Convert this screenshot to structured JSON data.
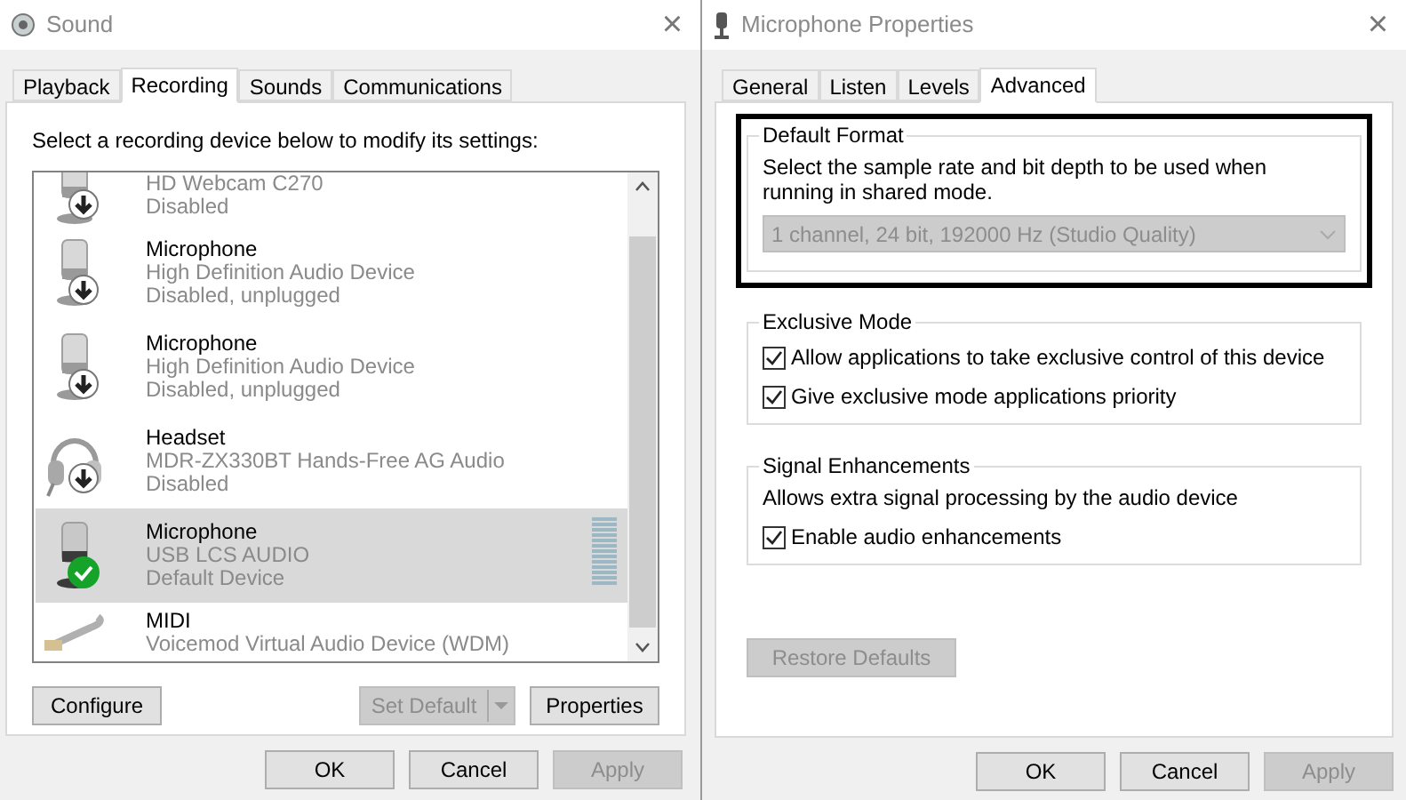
{
  "sound_window": {
    "title": "Sound",
    "close": "×",
    "tabs": [
      {
        "label": "Playback",
        "selected": false
      },
      {
        "label": "Recording",
        "selected": true
      },
      {
        "label": "Sounds",
        "selected": false
      },
      {
        "label": "Communications",
        "selected": false
      }
    ],
    "instruction": "Select a recording device below to modify its settings:",
    "devices": [
      {
        "kind": "webcam",
        "description": "HD Webcam C270",
        "status": "Disabled",
        "disabled": true,
        "default": false,
        "selected": false
      },
      {
        "kind": "mic",
        "name": "Microphone",
        "description": "High Definition Audio Device",
        "status": "Disabled, unplugged",
        "disabled": true,
        "default": false,
        "selected": false
      },
      {
        "kind": "mic",
        "name": "Microphone",
        "description": "High Definition Audio Device",
        "status": "Disabled, unplugged",
        "disabled": true,
        "default": false,
        "selected": false
      },
      {
        "kind": "headset",
        "name": "Headset",
        "description": "MDR-ZX330BT Hands-Free AG Audio",
        "status": "Disabled",
        "disabled": true,
        "default": false,
        "selected": false
      },
      {
        "kind": "mic",
        "name": "Microphone",
        "description": "USB LCS AUDIO",
        "status": "Default Device",
        "disabled": false,
        "default": true,
        "selected": true
      },
      {
        "kind": "midi",
        "name": "MIDI",
        "description": "Voicemod Virtual Audio Device (WDM)",
        "disabled": false,
        "default": false,
        "selected": false
      }
    ],
    "actions": [
      {
        "kind": "button",
        "label": "Configure",
        "disabled": false
      },
      {
        "kind": "split",
        "label": "Set Default",
        "disabled": true
      },
      {
        "kind": "button",
        "label": "Properties",
        "disabled": false
      }
    ],
    "buttons": [
      {
        "label": "OK",
        "disabled": false
      },
      {
        "label": "Cancel",
        "disabled": false
      },
      {
        "label": "Apply",
        "disabled": true
      }
    ]
  },
  "properties_window": {
    "title": "Microphone Properties",
    "close": "×",
    "tabs": [
      {
        "label": "General",
        "selected": false
      },
      {
        "label": "Listen",
        "selected": false
      },
      {
        "label": "Levels",
        "selected": false
      },
      {
        "label": "Advanced",
        "selected": true
      }
    ],
    "groups": [
      {
        "title": "Default Format",
        "highlighted": true,
        "text": "Select the sample rate and bit depth to be used when running in shared mode.",
        "dropdown": {
          "value": "1 channel, 24 bit, 192000 Hz (Studio Quality)",
          "disabled": true
        }
      },
      {
        "title": "Exclusive Mode",
        "highlighted": false,
        "options": [
          {
            "label": "Allow applications to take exclusive control of this device",
            "checked": true
          },
          {
            "label": "Give exclusive mode applications priority",
            "checked": true
          }
        ]
      },
      {
        "title": "Signal Enhancements",
        "highlighted": false,
        "text": "Allows extra signal processing by the audio device",
        "options": [
          {
            "label": "Enable audio enhancements",
            "checked": true
          }
        ]
      }
    ],
    "restore": {
      "label": "Restore Defaults",
      "disabled": true
    },
    "buttons": [
      {
        "label": "OK",
        "disabled": false
      },
      {
        "label": "Cancel",
        "disabled": false
      },
      {
        "label": "Apply",
        "disabled": true
      }
    ]
  }
}
